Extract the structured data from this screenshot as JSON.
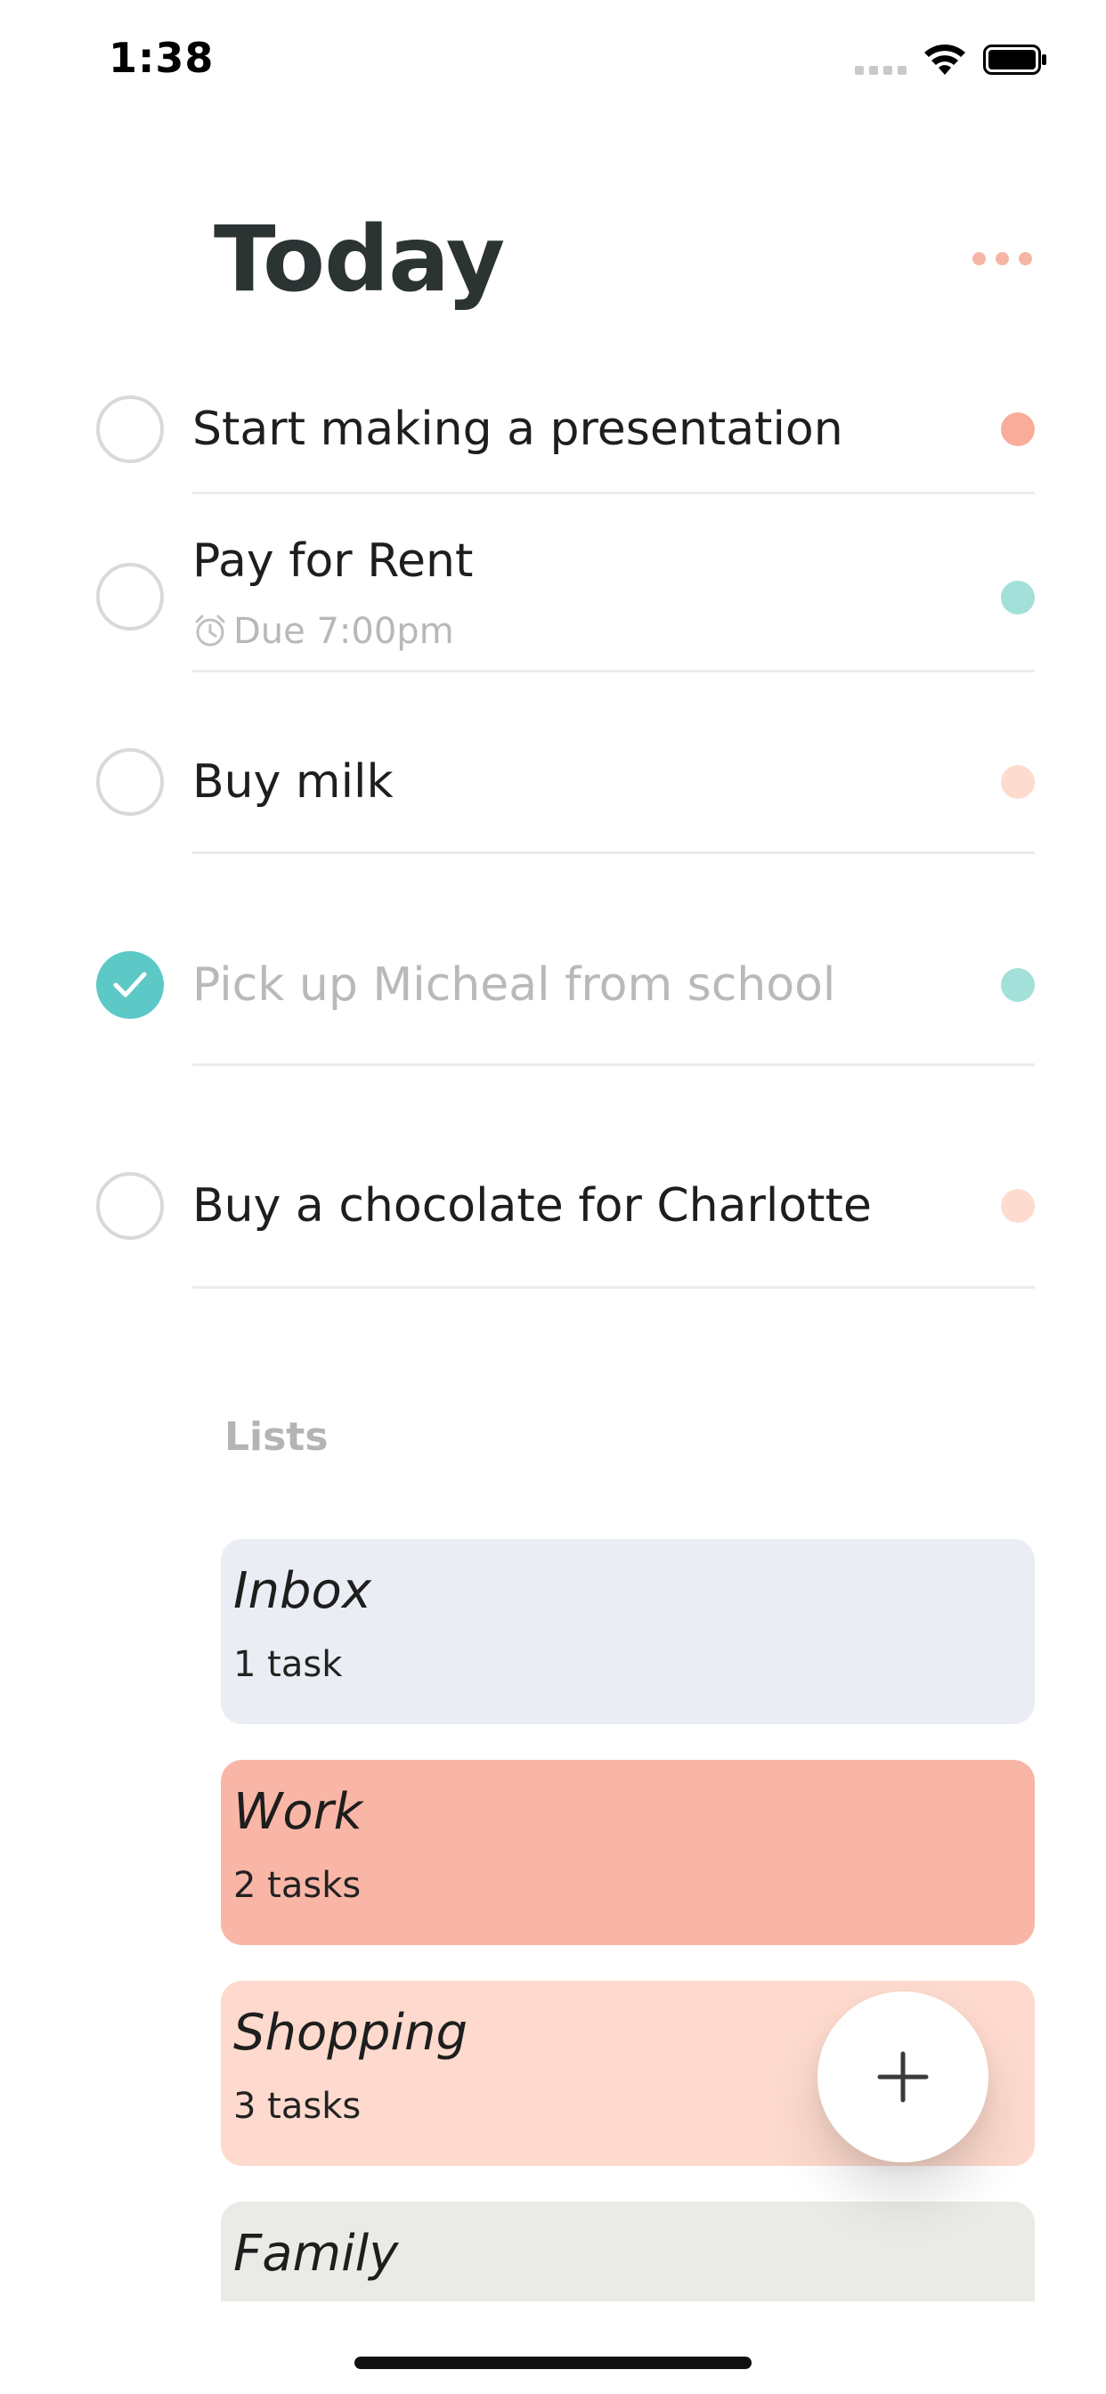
{
  "status_bar": {
    "time": "1:38"
  },
  "header": {
    "title": "Today"
  },
  "tasks": [
    {
      "title": "Start making a presentation",
      "subtitle": "",
      "completed": false,
      "color": "#f8ad9b"
    },
    {
      "title": "Pay for Rent",
      "subtitle": "Due 7:00pm",
      "completed": false,
      "color": "#a3e0d9"
    },
    {
      "title": "Buy milk",
      "subtitle": "",
      "completed": false,
      "color": "#fddccf"
    },
    {
      "title": "Pick up Micheal from school",
      "subtitle": "",
      "completed": true,
      "color": "#a3e0d9"
    },
    {
      "title": "Buy a chocolate for Charlotte",
      "subtitle": "",
      "completed": false,
      "color": "#fddccf"
    }
  ],
  "lists": {
    "header": "Lists",
    "items": [
      {
        "name": "Inbox",
        "count": "1 task",
        "color": "#eaedf4"
      },
      {
        "name": "Work",
        "count": "2 tasks",
        "color": "#f9b6a6"
      },
      {
        "name": "Shopping",
        "count": "3 tasks",
        "color": "#fddacd"
      },
      {
        "name": "Family",
        "count": "",
        "color": "#eaeae6"
      }
    ]
  },
  "icons": {
    "more": "more-horizontal-icon",
    "alarm": "alarm-clock-icon",
    "check": "checkmark-icon",
    "add": "plus-icon"
  },
  "colors": {
    "accent": "#5cc9c7",
    "title_text": "#2c3333"
  }
}
